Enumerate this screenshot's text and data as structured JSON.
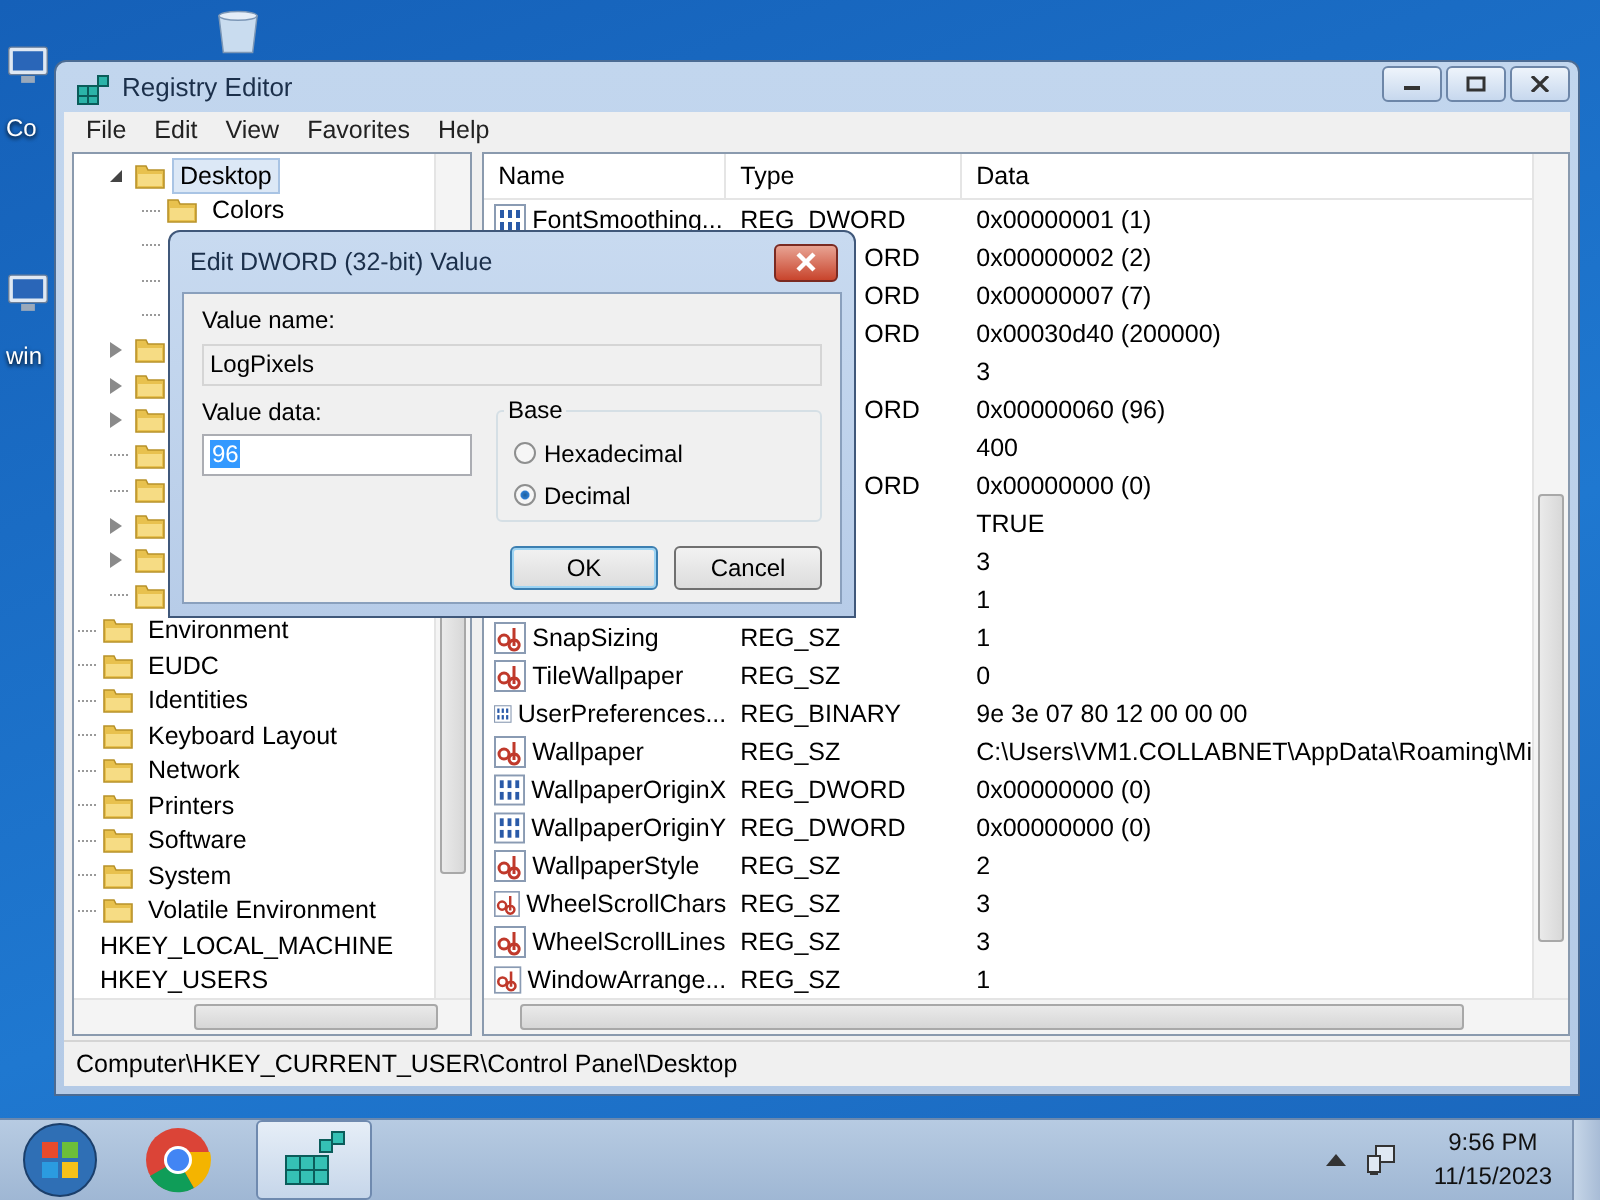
{
  "desktop_icons": [
    {
      "label": "Co"
    },
    {
      "label": "win"
    }
  ],
  "window": {
    "title": "Registry Editor",
    "menu": [
      "File",
      "Edit",
      "View",
      "Favorites",
      "Help"
    ]
  },
  "tree": {
    "items": [
      {
        "kind": "offscreen",
        "children": [
          {
            "kind": "offscreen",
            "children": [
              {
                "kind": "folder",
                "label": "Desktop",
                "expanded": true,
                "selected": true,
                "children": [
                  {
                    "kind": "folder",
                    "label": "Colors",
                    "selected": false
                  },
                  {
                    "kind": "covered"
                  },
                  {
                    "kind": "covered"
                  },
                  {
                    "kind": "covered"
                  }
                ]
              },
              {
                "kind": "folder",
                "expanded": false,
                "selected": false
              },
              {
                "kind": "folder",
                "expanded": false,
                "selected": false
              },
              {
                "kind": "folder",
                "expanded": false,
                "selected": false
              },
              {
                "kind": "folder",
                "selected": false
              },
              {
                "kind": "folder",
                "selected": false
              },
              {
                "kind": "folder",
                "expanded": false,
                "selected": false
              },
              {
                "kind": "folder",
                "expanded": false,
                "selected": false
              },
              {
                "kind": "folder",
                "selected": false
              }
            ]
          },
          {
            "kind": "folder",
            "label": "Environment",
            "selected": false
          },
          {
            "kind": "folder",
            "label": "EUDC",
            "selected": false
          },
          {
            "kind": "folder",
            "label": "Identities",
            "selected": false
          },
          {
            "kind": "folder",
            "label": "Keyboard Layout",
            "selected": false
          },
          {
            "kind": "folder",
            "label": "Network",
            "selected": false
          },
          {
            "kind": "folder",
            "label": "Printers",
            "selected": false
          },
          {
            "kind": "folder",
            "label": "Software",
            "selected": false
          },
          {
            "kind": "folder",
            "label": "System",
            "selected": false
          },
          {
            "kind": "folder",
            "label": "Volatile Environment",
            "selected": false
          }
        ]
      },
      {
        "kind": "root",
        "label": "HKEY_LOCAL_MACHINE",
        "selected": false
      },
      {
        "kind": "root",
        "label": "HKEY_USERS",
        "selected": false
      }
    ]
  },
  "table": {
    "columns": [
      "Name",
      "Type",
      "Data"
    ],
    "rows": [
      {
        "kind": "binary",
        "name": "FontSmoothing...",
        "type": "REG_DWORD",
        "data": "0x00000001 (1)"
      },
      {
        "type": "ORD",
        "data": "0x00000002 (2)"
      },
      {
        "type": "ORD",
        "data": "0x00000007 (7)"
      },
      {
        "type": "ORD",
        "data": "0x00030d40 (200000)"
      },
      {
        "data": "3"
      },
      {
        "type": "ORD",
        "data": "0x00000060 (96)"
      },
      {
        "data": "400"
      },
      {
        "type": "ORD",
        "data": "0x00000000 (0)"
      },
      {
        "data": "TRUE"
      },
      {
        "data": "3"
      },
      {
        "data": "1"
      },
      {
        "kind": "string",
        "name": "SnapSizing",
        "type": "REG_SZ",
        "data": "1"
      },
      {
        "kind": "string",
        "name": "TileWallpaper",
        "type": "REG_SZ",
        "data": "0"
      },
      {
        "kind": "binary",
        "name": "UserPreferences...",
        "type": "REG_BINARY",
        "data": "9e 3e 07 80 12 00 00 00"
      },
      {
        "kind": "string",
        "name": "Wallpaper",
        "type": "REG_SZ",
        "data": "C:\\Users\\VM1.COLLABNET\\AppData\\Roaming\\Mi"
      },
      {
        "kind": "binary",
        "name": "WallpaperOriginX",
        "type": "REG_DWORD",
        "data": "0x00000000 (0)"
      },
      {
        "kind": "binary",
        "name": "WallpaperOriginY",
        "type": "REG_DWORD",
        "data": "0x00000000 (0)"
      },
      {
        "kind": "string",
        "name": "WallpaperStyle",
        "type": "REG_SZ",
        "data": "2"
      },
      {
        "kind": "string",
        "name": "WheelScrollChars",
        "type": "REG_SZ",
        "data": "3"
      },
      {
        "kind": "string",
        "name": "WheelScrollLines",
        "type": "REG_SZ",
        "data": "3"
      },
      {
        "kind": "string",
        "name": "WindowArrange...",
        "type": "REG_SZ",
        "data": "1"
      }
    ]
  },
  "status_bar": "Computer\\HKEY_CURRENT_USER\\Control Panel\\Desktop",
  "dialog": {
    "title": "Edit DWORD (32-bit) Value",
    "value_name_label": "Value name:",
    "value_name": "LogPixels",
    "value_data_label": "Value data:",
    "value_data": "96",
    "value_data_selected": true,
    "base": {
      "title": "Base",
      "options": [
        {
          "label": "Hexadecimal",
          "selected": false
        },
        {
          "label": "Decimal",
          "selected": true
        }
      ]
    },
    "buttons": [
      {
        "label": "OK",
        "default": true
      },
      {
        "label": "Cancel",
        "default": false
      }
    ]
  },
  "taskbar": {
    "items": [
      {
        "kind": "chrome",
        "active": false
      },
      {
        "kind": "regedit",
        "active": true
      }
    ],
    "time": "9:56 PM",
    "date": "11/15/2023"
  }
}
